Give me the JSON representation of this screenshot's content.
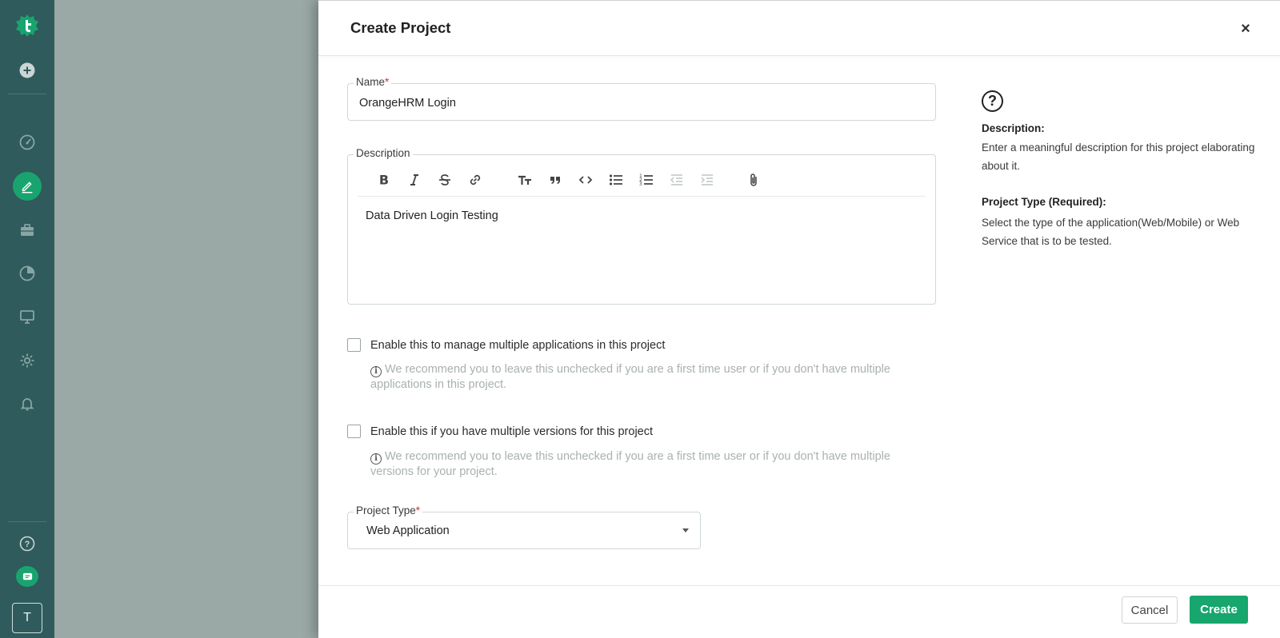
{
  "colors": {
    "sidebar": "#2f5b5c",
    "accent": "#17a66d",
    "required": "#d32f2f",
    "hint": "#a9b0b0"
  },
  "sidebar": {
    "icons": [
      "logo-icon",
      "add-icon",
      "dashboard-icon",
      "edit-icon",
      "briefcase-icon",
      "reports-icon",
      "monitor-icon",
      "settings-icon",
      "bell-icon",
      "help-icon",
      "chat-icon"
    ],
    "avatar_initial": "T"
  },
  "modal": {
    "title": "Create Project",
    "close_label": "×"
  },
  "form": {
    "name": {
      "label": "Name",
      "required_mark": "*",
      "value": "OrangeHRM Login"
    },
    "description": {
      "label": "Description",
      "value": "Data Driven Login Testing",
      "toolbar": [
        "bold-icon",
        "italic-icon",
        "strikethrough-icon",
        "link-icon",
        "text-size-icon",
        "quote-icon",
        "code-icon",
        "bulleted-list-icon",
        "numbered-list-icon",
        "outdent-icon",
        "indent-icon",
        "attachment-icon"
      ]
    },
    "multi_app": {
      "label": "Enable this to manage multiple applications in this project",
      "hint": "We recommend you to leave this unchecked if you are a first time user or if you don't have multiple applications in this project.",
      "checked": false
    },
    "multi_version": {
      "label": "Enable this if you have multiple versions for this project",
      "hint": "We recommend you to leave this unchecked if you are a first time user or if you don't have multiple versions for your project.",
      "checked": false
    },
    "project_type": {
      "label": "Project Type",
      "required_mark": "*",
      "value": "Web Application"
    }
  },
  "help": {
    "icon_glyph": "?",
    "description_heading": "Description:",
    "description_text": "Enter a meaningful description for this project elaborating about it.",
    "type_heading": "Project Type (Required):",
    "type_text": "Select the type of the application(Web/Mobile) or Web Service that is to be tested."
  },
  "footer": {
    "cancel_label": "Cancel",
    "create_label": "Create"
  }
}
